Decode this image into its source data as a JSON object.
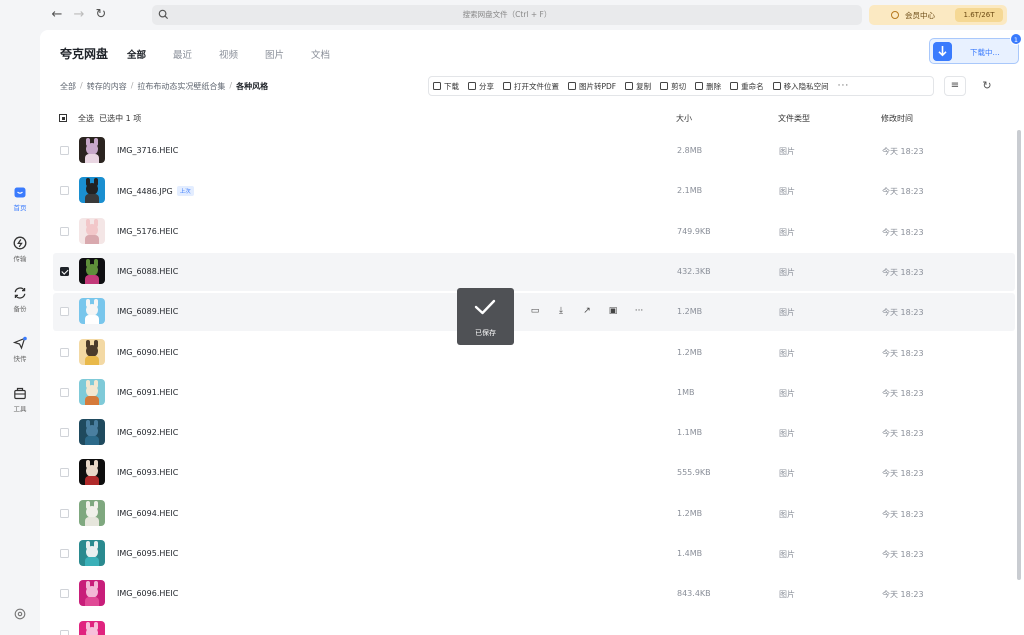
{
  "top_bar": {
    "back_glyph": "←",
    "forward_glyph": "→",
    "refresh_glyph": "↻",
    "search_placeholder": "搜索网盘文件（Ctrl + F）",
    "vip_label": "会员中心",
    "quota": "1.6T/26T"
  },
  "sidebar": {
    "items": [
      {
        "label": "首页",
        "icon": "home-icon",
        "active": true
      },
      {
        "label": "传输",
        "icon": "transfer-icon",
        "active": false
      },
      {
        "label": "备份",
        "icon": "backup-icon",
        "active": false
      },
      {
        "label": "快传",
        "icon": "quick-send-icon",
        "active": false
      },
      {
        "label": "工具",
        "icon": "toolbox-icon",
        "active": false
      }
    ],
    "settings_icon": "settings-icon"
  },
  "header": {
    "brand": "夸克网盘",
    "tabs": [
      "全部",
      "最近",
      "视频",
      "图片",
      "文档"
    ],
    "active_tab": "全部",
    "download_label": "下载中...",
    "download_badge": "1"
  },
  "breadcrumb": [
    "全部",
    "转存的内容",
    "拉布布动态实况壁纸合集",
    "各种风格"
  ],
  "toolbar": {
    "items": [
      "下载",
      "分享",
      "打开文件位置",
      "图片转PDF",
      "复制",
      "剪切",
      "删除",
      "重命名",
      "移入隐私空间"
    ],
    "more": "···",
    "sort_glyph": "≡",
    "refresh_glyph": "↻"
  },
  "table": {
    "select_all": "全选",
    "selected_count": "已选中 1 项",
    "col_size": "大小",
    "col_type": "文件类型",
    "col_time": "修改时间",
    "rows": [
      {
        "name": "IMG_3716.HEIC",
        "tag": "",
        "size": "2.8MB",
        "type": "图片",
        "time": "今天 18:23",
        "checked": false,
        "colors": [
          "#2b2420",
          "#c7a8c9",
          "#e9d6e2"
        ]
      },
      {
        "name": "IMG_4486.JPG",
        "tag": "上次",
        "size": "2.1MB",
        "type": "图片",
        "time": "今天 18:23",
        "checked": false,
        "colors": [
          "#1a8fd0",
          "#222222",
          "#3a3a3a"
        ]
      },
      {
        "name": "IMG_5176.HEIC",
        "tag": "",
        "size": "749.9KB",
        "type": "图片",
        "time": "今天 18:23",
        "checked": false,
        "colors": [
          "#f4e6e6",
          "#f2c7c9",
          "#d9a9ae"
        ]
      },
      {
        "name": "IMG_6088.HEIC",
        "tag": "",
        "size": "432.3KB",
        "type": "图片",
        "time": "今天 18:23",
        "checked": true,
        "colors": [
          "#0f0f12",
          "#5e8f3a",
          "#c33a7a"
        ]
      },
      {
        "name": "IMG_6089.HEIC",
        "tag": "",
        "size": "1.2MB",
        "type": "图片",
        "time": "今天 18:23",
        "checked": false,
        "colors": [
          "#78c6ec",
          "#f5f5f5",
          "#ffffff"
        ]
      },
      {
        "name": "IMG_6090.HEIC",
        "tag": "",
        "size": "1.2MB",
        "type": "图片",
        "time": "今天 18:23",
        "checked": false,
        "colors": [
          "#f3d9a4",
          "#4b3b2b",
          "#e9b94a"
        ]
      },
      {
        "name": "IMG_6091.HEIC",
        "tag": "",
        "size": "1MB",
        "type": "图片",
        "time": "今天 18:23",
        "checked": false,
        "colors": [
          "#7fcad8",
          "#f3e7d0",
          "#d57a3a"
        ]
      },
      {
        "name": "IMG_6092.HEIC",
        "tag": "",
        "size": "1.1MB",
        "type": "图片",
        "time": "今天 18:23",
        "checked": false,
        "colors": [
          "#1f4a5e",
          "#4a7fa0",
          "#2c6a8a"
        ]
      },
      {
        "name": "IMG_6093.HEIC",
        "tag": "",
        "size": "555.9KB",
        "type": "图片",
        "time": "今天 18:23",
        "checked": false,
        "colors": [
          "#0e0e0e",
          "#e8d8c8",
          "#b02a2a"
        ]
      },
      {
        "name": "IMG_6094.HEIC",
        "tag": "",
        "size": "1.2MB",
        "type": "图片",
        "time": "今天 18:23",
        "checked": false,
        "colors": [
          "#7fa87f",
          "#f1f1ea",
          "#e6e6dc"
        ]
      },
      {
        "name": "IMG_6095.HEIC",
        "tag": "",
        "size": "1.4MB",
        "type": "图片",
        "time": "今天 18:23",
        "checked": false,
        "colors": [
          "#2a8a8f",
          "#e8f0f0",
          "#3ab0b8"
        ]
      },
      {
        "name": "IMG_6096.HEIC",
        "tag": "",
        "size": "843.4KB",
        "type": "图片",
        "time": "今天 18:23",
        "checked": false,
        "colors": [
          "#c81e7a",
          "#f3b8d6",
          "#e04a96"
        ]
      },
      {
        "name": "",
        "tag": "",
        "size": "",
        "type": "",
        "time": "",
        "checked": false,
        "colors": [
          "#e0247f",
          "#f7c0da",
          "#f0a0c8"
        ]
      }
    ],
    "row_actions": [
      "folder-icon",
      "download-icon",
      "share-icon",
      "image-icon",
      "more-icon"
    ]
  },
  "toast": {
    "text": "已保存",
    "icon": "checkmark-icon"
  },
  "colors": {
    "accent": "#3a7bfd",
    "vip_bg": "#fbe9c2"
  }
}
